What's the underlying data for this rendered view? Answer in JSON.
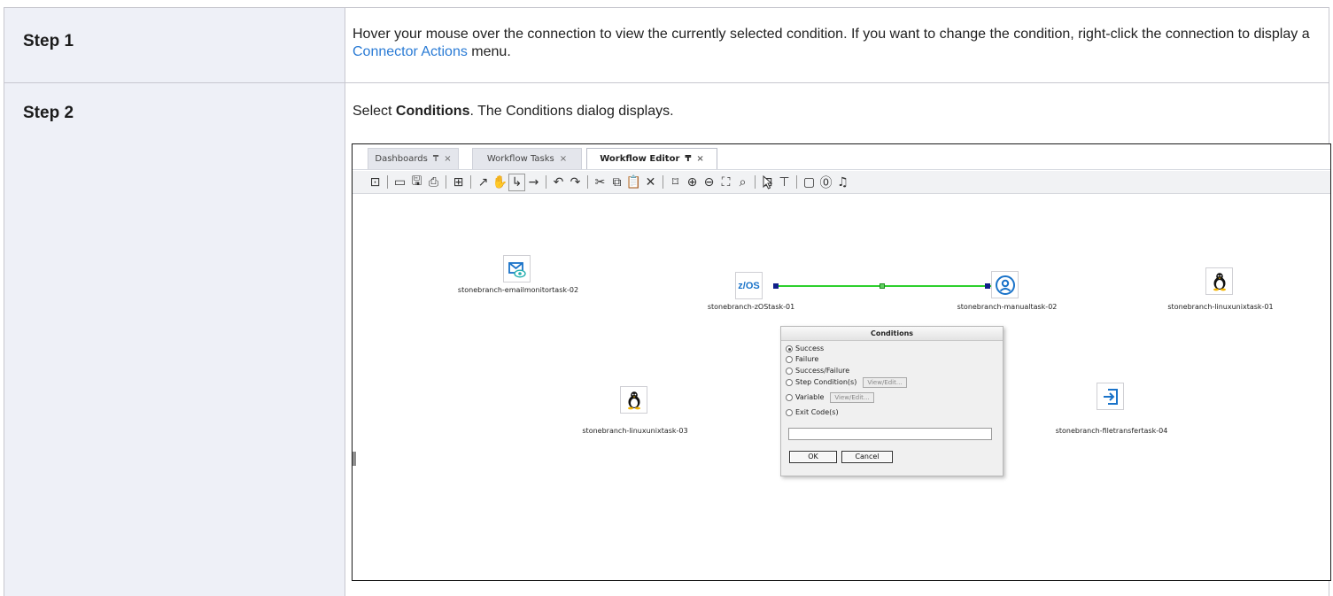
{
  "steps": [
    {
      "label": "Step 1",
      "text_before_link": "Hover your mouse over the connection to view the currently selected condition. If you want to change the condition, right-click the connection to display a ",
      "link_text": "Connector Actions",
      "text_after_link": " menu."
    },
    {
      "label": "Step 2",
      "text_prefix": "Select ",
      "text_bold": "Conditions",
      "text_suffix": ". The Conditions dialog displays."
    }
  ],
  "screenshot": {
    "tabs": [
      {
        "label": "Dashboards",
        "pin": "₸",
        "close": "×"
      },
      {
        "label": "Workflow Tasks",
        "pin": "",
        "close": "×"
      },
      {
        "label": "Workflow Editor",
        "pin": "₸",
        "close": "×"
      }
    ],
    "toolbar_icons": [
      "zoom-fit-icon",
      "open-folder-icon",
      "save-icon",
      "print-icon",
      "add-icon",
      "arrow-icon",
      "pan-hand-icon",
      "connector-elbow-icon",
      "connector-straight-icon",
      "undo-icon",
      "redo-icon",
      "cut-icon",
      "copy-icon",
      "paste-icon",
      "delete-icon",
      "fit-page-icon",
      "zoom-in-icon",
      "zoom-out-icon",
      "zoom-area-icon",
      "search-icon",
      "layout-icon",
      "hierarchy-icon",
      "monitor-icon",
      "help-icon",
      "bell-icon"
    ],
    "nodes": [
      {
        "label": "stonebranch-emailmonitortask-02",
        "icon": "email-monitor-icon"
      },
      {
        "label": "stonebranch-zOStask-01",
        "icon": "zos-icon",
        "icon_text": "z/OS"
      },
      {
        "label": "stonebranch-manualtask-02",
        "icon": "manual-user-icon"
      },
      {
        "label": "stonebranch-linuxunixtask-01",
        "icon": "linux-penguin-icon"
      },
      {
        "label": "stonebranch-linuxunixtask-03",
        "icon": "linux-penguin-icon"
      },
      {
        "label": "stonebranch-filetransfertask-04",
        "icon": "file-transfer-icon"
      }
    ],
    "dialog": {
      "title": "Conditions",
      "options": [
        "Success",
        "Failure",
        "Success/Failure",
        "Step Condition(s)",
        "Variable",
        "Exit Code(s)"
      ],
      "selected": "Success",
      "view_edit": "View/Edit...",
      "ok": "OK",
      "cancel": "Cancel"
    }
  },
  "colors": {
    "link": "#2a7bd5",
    "step_cell_bg": "#eef0f7",
    "connector_line": "#2dd02d",
    "node_icon_blue": "#1a73c9"
  }
}
